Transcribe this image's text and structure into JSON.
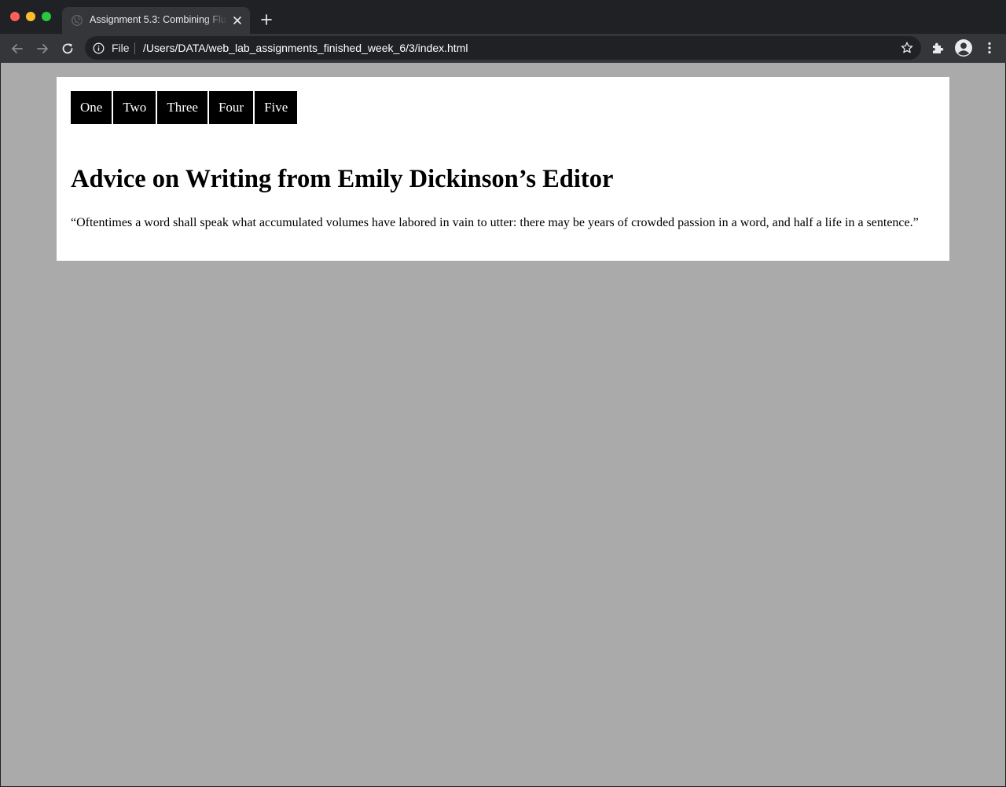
{
  "browser": {
    "tab": {
      "title": "Assignment 5.3: Combining Flu"
    },
    "omnibox": {
      "scheme_label": "File",
      "url": "/Users/DATA/web_lab_assignments_finished_week_6/3/index.html"
    }
  },
  "page": {
    "nav_items": [
      "One",
      "Two",
      "Three",
      "Four",
      "Five"
    ],
    "heading": "Advice on Writing from Emily Dickinson’s Editor",
    "quote": "“Oftentimes a word shall speak what accumulated volumes have labored in vain to utter: there may be years of crowded passion in a word, and half a life in a sentence.”"
  },
  "colors": {
    "chrome_dark": "#202124",
    "chrome_tab": "#35363a",
    "page_background": "#aaaaaa",
    "nav_background": "#000000"
  }
}
